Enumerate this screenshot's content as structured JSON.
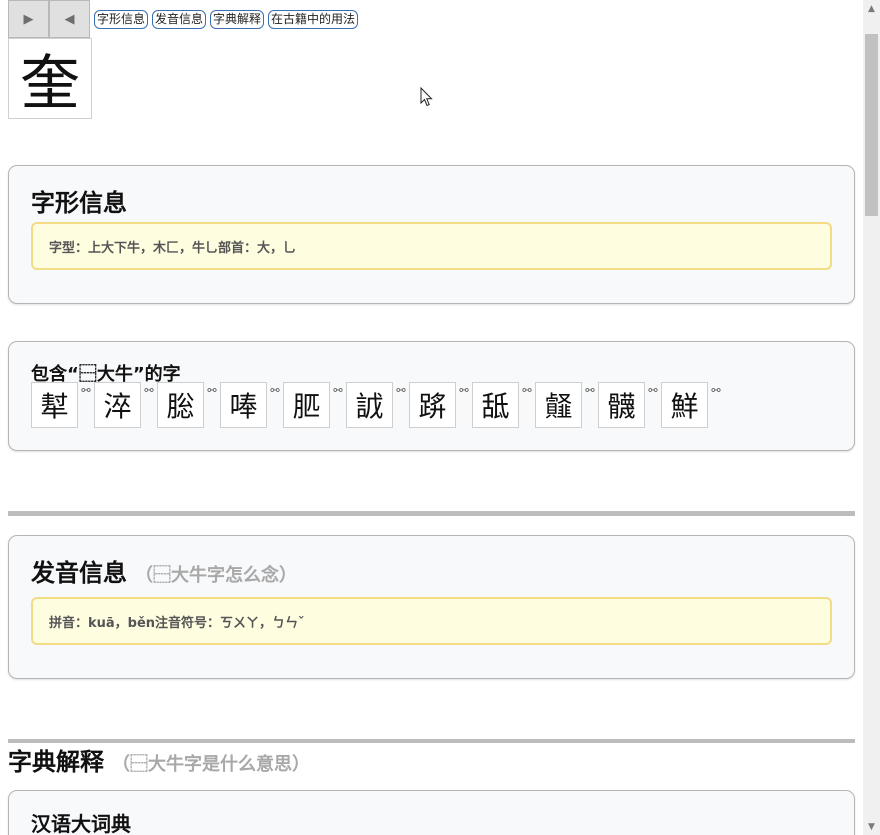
{
  "nav": {
    "next_icon": "▶",
    "prev_icon": "◀",
    "tags": [
      "字形信息",
      "发音信息",
      "字典解释",
      "在古籍中的用法"
    ]
  },
  "main_char": "⿱大牛",
  "main_char_display": "奎",
  "form": {
    "title": "字形信息",
    "note": "字型：上大下牛，⽊匚，⽜乚部首：大，乚"
  },
  "contains": {
    "title": "包含“⿱大牛”的字",
    "chars": [
      "犎",
      "淬",
      "䐋",
      "唪",
      "䏘",
      "䛋",
      "䟸",
      "䑛",
      "䪥",
      "䯦",
      "鮮"
    ]
  },
  "pron": {
    "title": "发音信息",
    "hint": "（⿱大牛字怎么念）",
    "note": "拼音：kuā，běn注音符号：ㄎㄨㄚ，ㄅㄣˇ"
  },
  "dict": {
    "title": "字典解释",
    "hint": "（⿱大牛字是什么意思）",
    "sub": "汉语大词典"
  }
}
